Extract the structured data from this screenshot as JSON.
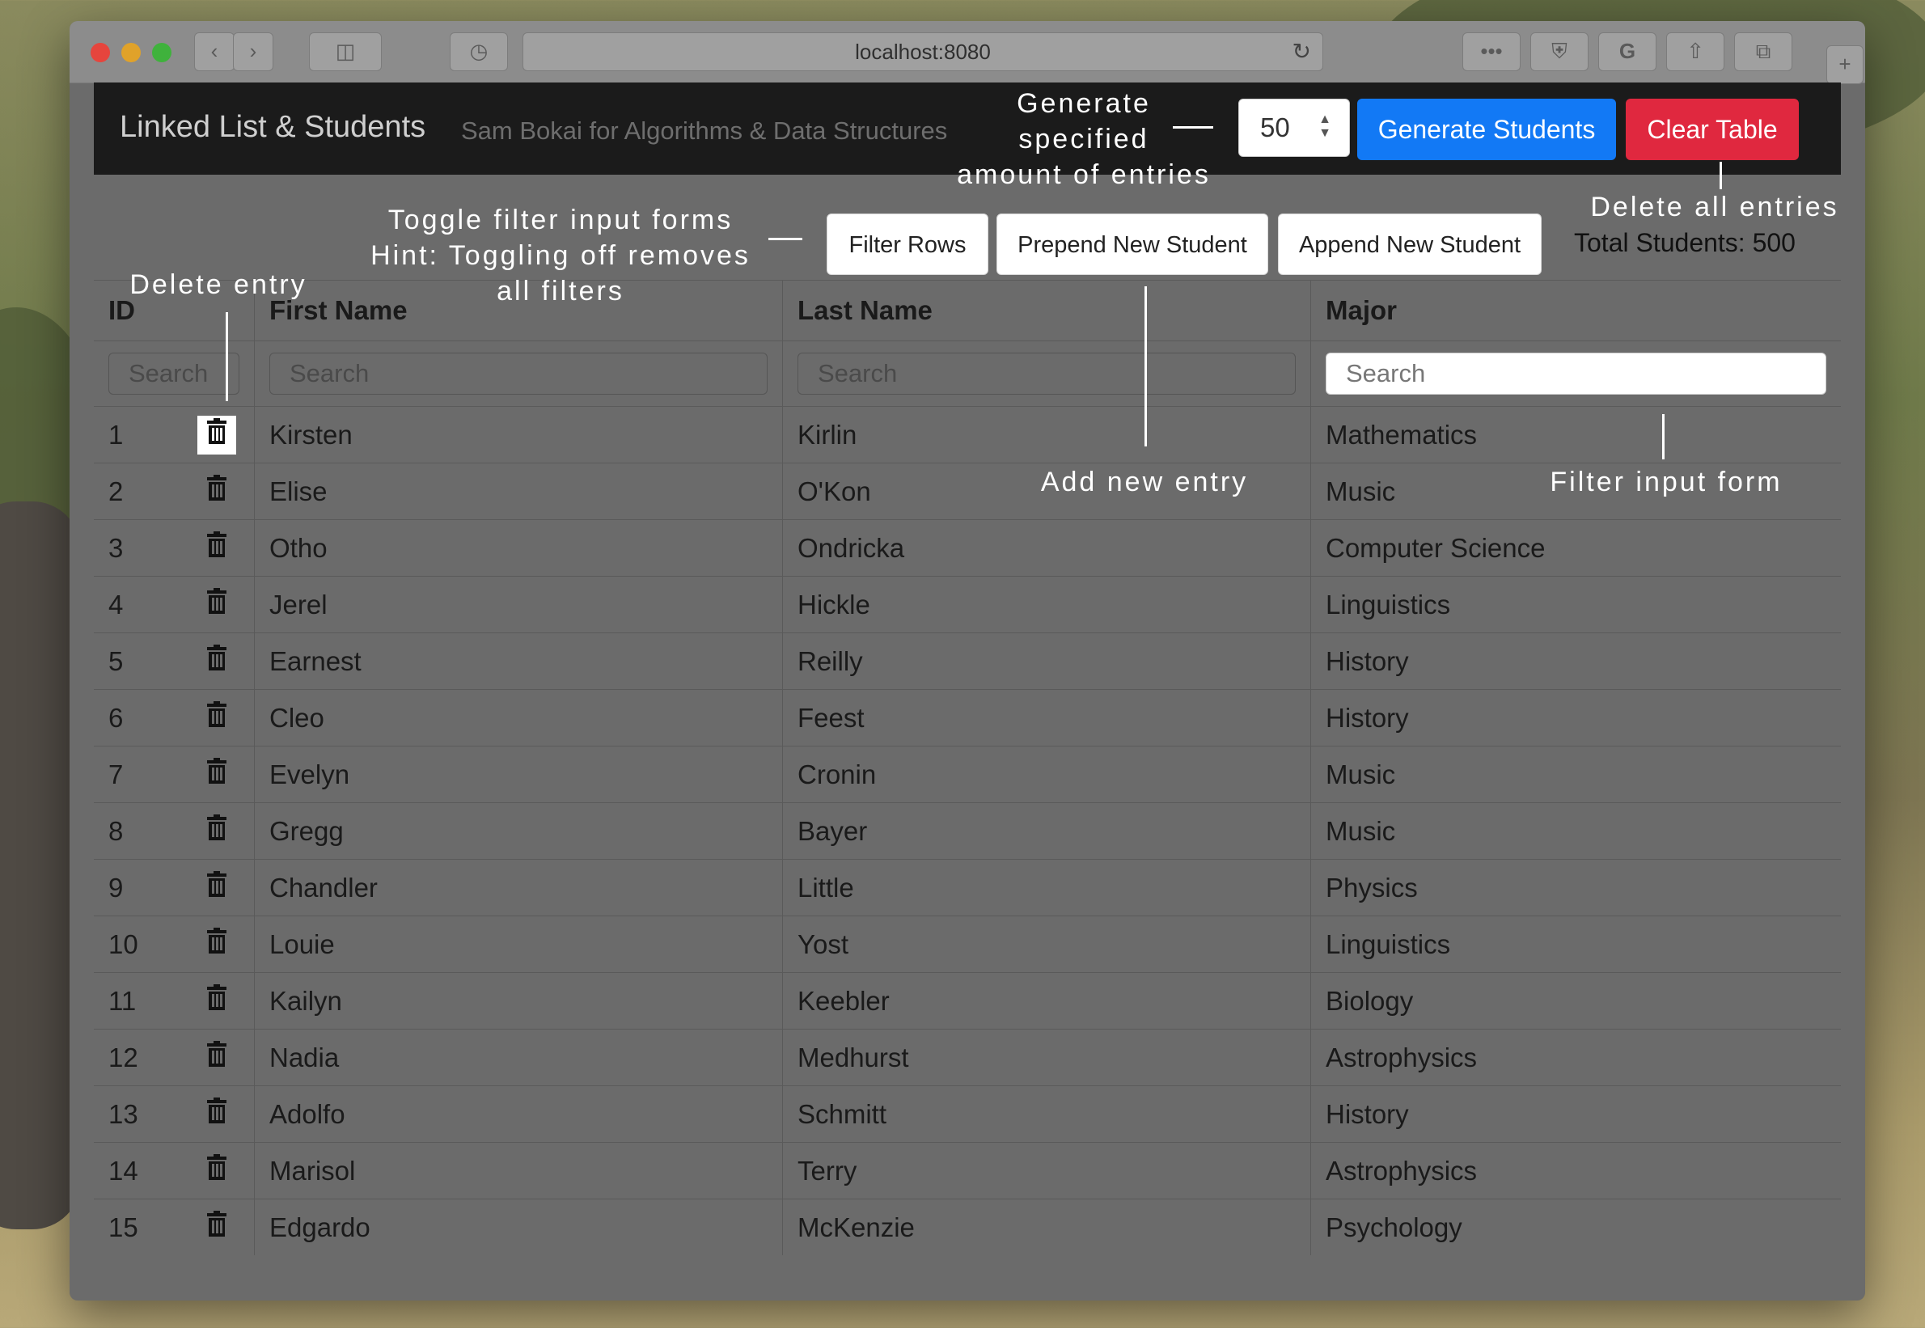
{
  "browser": {
    "url": "localhost:8080"
  },
  "navbar": {
    "brand": "Linked List & Students",
    "subtitle": "Sam Bokai for Algorithms & Data Structures",
    "count_value": "50",
    "generate_label": "Generate Students",
    "clear_label": "Clear Table"
  },
  "toolbar": {
    "filter_label": "Filter Rows",
    "prepend_label": "Prepend New Student",
    "append_label": "Append New Student",
    "total": "Total Students: 500"
  },
  "table": {
    "headers": [
      "ID",
      "First Name",
      "Last Name",
      "Major"
    ],
    "search_placeholder": "Search",
    "rows": [
      {
        "id": "1",
        "first": "Kirsten",
        "last": "Kirlin",
        "major": "Mathematics"
      },
      {
        "id": "2",
        "first": "Elise",
        "last": "O'Kon",
        "major": "Music"
      },
      {
        "id": "3",
        "first": "Otho",
        "last": "Ondricka",
        "major": "Computer Science"
      },
      {
        "id": "4",
        "first": "Jerel",
        "last": "Hickle",
        "major": "Linguistics"
      },
      {
        "id": "5",
        "first": "Earnest",
        "last": "Reilly",
        "major": "History"
      },
      {
        "id": "6",
        "first": "Cleo",
        "last": "Feest",
        "major": "History"
      },
      {
        "id": "7",
        "first": "Evelyn",
        "last": "Cronin",
        "major": "Music"
      },
      {
        "id": "8",
        "first": "Gregg",
        "last": "Bayer",
        "major": "Music"
      },
      {
        "id": "9",
        "first": "Chandler",
        "last": "Little",
        "major": "Physics"
      },
      {
        "id": "10",
        "first": "Louie",
        "last": "Yost",
        "major": "Linguistics"
      },
      {
        "id": "11",
        "first": "Kailyn",
        "last": "Keebler",
        "major": "Biology"
      },
      {
        "id": "12",
        "first": "Nadia",
        "last": "Medhurst",
        "major": "Astrophysics"
      },
      {
        "id": "13",
        "first": "Adolfo",
        "last": "Schmitt",
        "major": "History"
      },
      {
        "id": "14",
        "first": "Marisol",
        "last": "Terry",
        "major": "Astrophysics"
      },
      {
        "id": "15",
        "first": "Edgardo",
        "last": "McKenzie",
        "major": "Psychology"
      }
    ]
  },
  "annotations": {
    "generate": [
      "Generate",
      "specified",
      "amount of entries"
    ],
    "delete_all": "Delete all entries",
    "toggle": [
      "Toggle filter input forms",
      "Hint: Toggling off removes",
      "all filters"
    ],
    "delete_entry": "Delete entry",
    "add_entry": "Add new entry",
    "filter_form": "Filter input form"
  },
  "icons": {
    "trash": "trash-icon"
  },
  "colors": {
    "primary": "#1279f5",
    "danger": "#e0283f",
    "navbar": "#1b1b1b"
  }
}
